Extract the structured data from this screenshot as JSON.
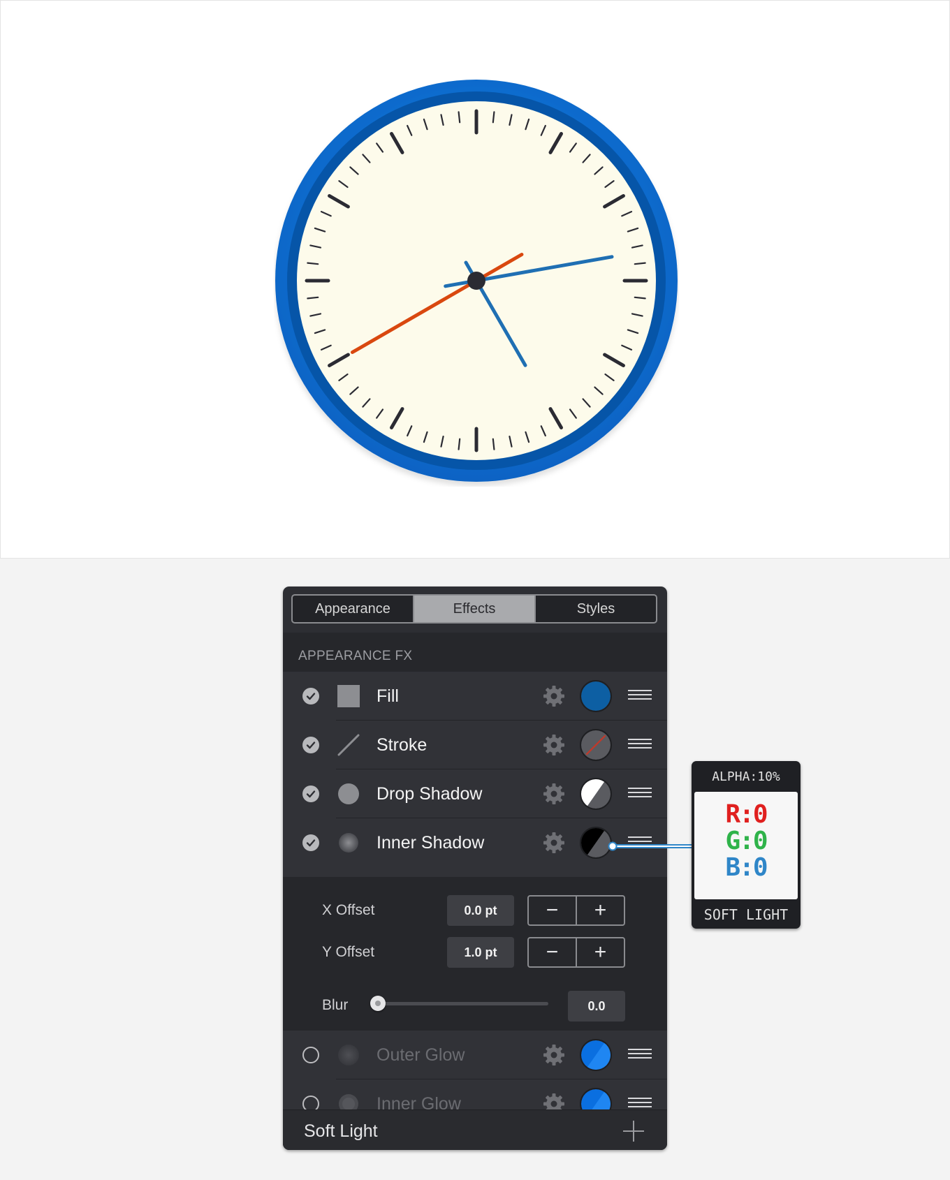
{
  "clock": {
    "hour_hand_angle_deg": 150,
    "minute_hand_angle_deg": 80,
    "second_hand_angle_deg": 240,
    "colors": {
      "bezel": "#0b72cf",
      "face": "#fdfbeb",
      "ticks": "#2b2b33",
      "hands": "#1f6fb3",
      "second_hand": "#d9480f"
    }
  },
  "panel": {
    "tabs": [
      {
        "label": "Appearance",
        "active": false
      },
      {
        "label": "Effects",
        "active": true
      },
      {
        "label": "Styles",
        "active": false
      }
    ],
    "section_title": "APPEARANCE FX",
    "effects": [
      {
        "label": "Fill",
        "checked": true,
        "icon": "square-icon",
        "swatch": "solid-blue",
        "color": "#0d5fa3"
      },
      {
        "label": "Stroke",
        "checked": true,
        "icon": "line-icon",
        "swatch": "stroke",
        "color": "#c0392b"
      },
      {
        "label": "Drop Shadow",
        "checked": true,
        "icon": "circle-icon",
        "swatch": "half-white"
      },
      {
        "label": "Inner Shadow",
        "checked": true,
        "icon": "soft-circle-icon",
        "swatch": "half-black"
      }
    ],
    "inner_shadow_settings": {
      "x_offset_label": "X Offset",
      "x_offset_value": "0.0 pt",
      "y_offset_label": "Y Offset",
      "y_offset_value": "1.0 pt",
      "blur_label": "Blur",
      "blur_value": "0.0",
      "blur_fraction": 0
    },
    "disabled_effects": [
      {
        "label": "Outer Glow",
        "checked": false,
        "icon": "soft-circle-icon",
        "swatch": "blue",
        "color": "#0a6fe0"
      },
      {
        "label": "Inner Glow",
        "checked": false,
        "icon": "soft-circle-icon",
        "swatch": "blue",
        "color": "#0a6fe0"
      }
    ],
    "footer_label": "Soft Light",
    "stepper_minus": "−",
    "stepper_plus": "+"
  },
  "callout": {
    "alpha": "ALPHA:10%",
    "r": "R:0",
    "g": "G:0",
    "b": "B:0",
    "mode": "SOFT LIGHT",
    "colors": {
      "r": "#e0201f",
      "g": "#2fb34a",
      "b": "#2f86c8"
    }
  }
}
